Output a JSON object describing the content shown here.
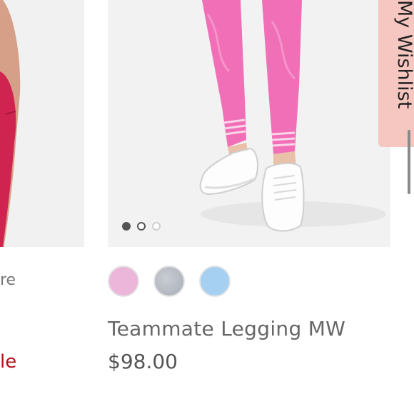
{
  "left_product": {
    "partial_name": "re",
    "partial_sale": "le"
  },
  "main_product": {
    "image_alt": "Pink ribbed leggings with white sneakers",
    "carousel": {
      "total": 3,
      "active": 1
    },
    "swatches": [
      {
        "name": "pink",
        "color": "#ecb6da"
      },
      {
        "name": "heather-grey",
        "color": "#b9bec6"
      },
      {
        "name": "light-blue",
        "color": "#a6d0f1"
      }
    ],
    "title": "Teammate Legging MW",
    "price": "$98.00"
  },
  "wishlist": {
    "label": "My Wishlist",
    "accent": "#f6c7c0"
  },
  "colors": {
    "sale_red": "#b4121b",
    "legging_pink": "#f06fb7"
  }
}
